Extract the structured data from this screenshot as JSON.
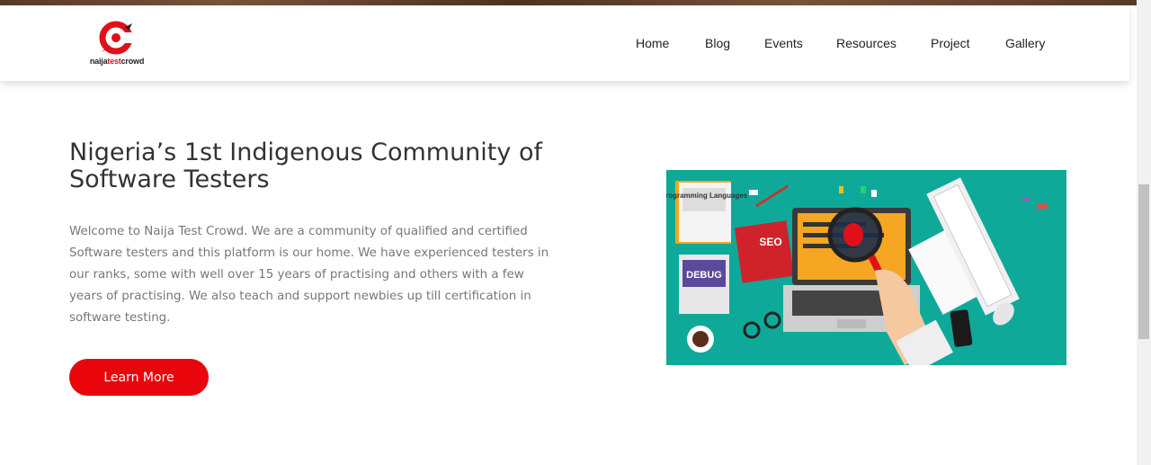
{
  "header": {
    "logo_text_dark": "naija",
    "logo_text_red": "test",
    "logo_text_dark2": "crowd",
    "nav": [
      "Home",
      "Blog",
      "Events",
      "Resources",
      "Project",
      "Gallery"
    ]
  },
  "hero": {
    "title": "Nigeria’s 1st Indigenous Community of Software Testers",
    "body": "Welcome to Naija Test Crowd. We are a community of qualified and certified Software testers and this platform is our home. We have experienced testers in our ranks, some with well over 15 years of practising and others with a few years of practising. We also teach and support newbies up till certification in software testing.",
    "cta_label": "Learn More"
  },
  "illustration": {
    "book1": "Programming Languages",
    "book2": "SEO",
    "book3": "DEBUG"
  },
  "colors": {
    "brand_red": "#e8060c",
    "illustration_bg": "#0fa99a"
  }
}
